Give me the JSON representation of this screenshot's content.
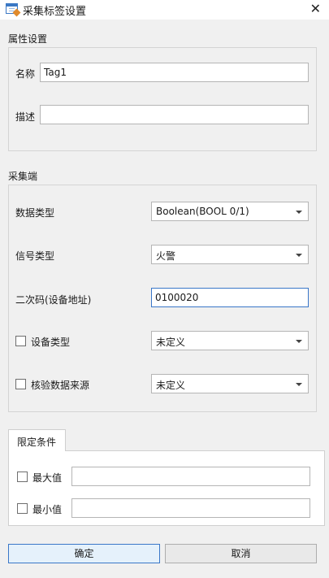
{
  "window": {
    "title": "采集标签设置"
  },
  "properties": {
    "section_label": "属性设置",
    "name_label": "名称",
    "name_value": "Tag1",
    "desc_label": "描述",
    "desc_value": ""
  },
  "acquisition": {
    "section_label": "采集端",
    "data_type_label": "数据类型",
    "data_type_value": "Boolean(BOOL 0/1)",
    "signal_type_label": "信号类型",
    "signal_type_value": "火警",
    "secondary_code_label": "二次码(设备地址)",
    "secondary_code_value": "0100020",
    "device_type_label": "设备类型",
    "device_type_checked": false,
    "device_type_value": "未定义",
    "verify_source_label": "核验数据来源",
    "verify_source_checked": false,
    "verify_source_value": "未定义"
  },
  "limits": {
    "tab_label": "限定条件",
    "max_label": "最大值",
    "max_checked": false,
    "max_value": "",
    "min_label": "最小值",
    "min_checked": false,
    "min_value": ""
  },
  "buttons": {
    "ok_label": "确定",
    "cancel_label": "取消"
  },
  "colors": {
    "accent": "#3a77c8",
    "window_bg": "#f0f0f0"
  }
}
